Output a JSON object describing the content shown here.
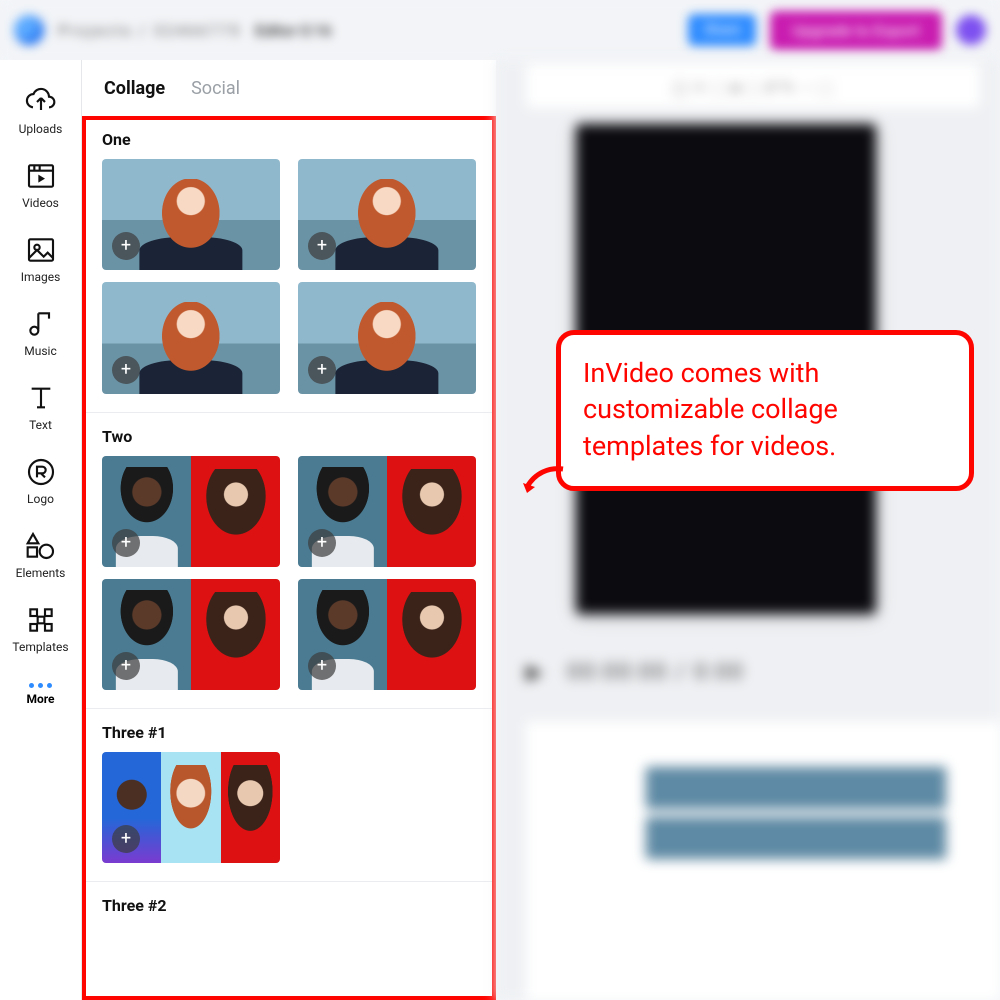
{
  "topbar": {
    "project_label": "Projects",
    "project_id": "32466775",
    "editor_text": "Editor  0:16",
    "preview_btn": "Share",
    "upgrade_btn": "Upgrade to Export"
  },
  "sidebar": {
    "uploads": "Uploads",
    "videos": "Videos",
    "images": "Images",
    "music": "Music",
    "text": "Text",
    "logo": "Logo",
    "elements": "Elements",
    "templates": "Templates",
    "more": "More"
  },
  "tabs": {
    "collage": "Collage",
    "social": "Social"
  },
  "groups": {
    "one": "One",
    "two": "Two",
    "three1": "Three #1",
    "three2": "Three #2"
  },
  "canvas": {
    "time_display": "00:00:00 / 0:00"
  },
  "callout": {
    "text": "InVideo comes with customizable collage templates for videos."
  }
}
